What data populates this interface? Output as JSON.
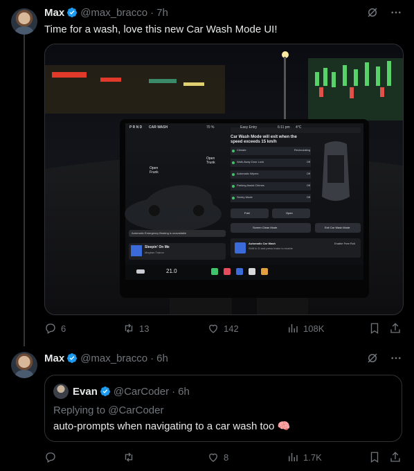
{
  "tweet1": {
    "author_name": "Max",
    "handle": "@max_bracco",
    "time": "7h",
    "text": "Time for a wash, love this new Car Wash Mode UI!",
    "media": {
      "top_bar": {
        "gear": "P R N D",
        "mode": "CAR WASH",
        "battery": "70 %",
        "entry": "Easy Entry",
        "clock": "6:11 pm",
        "temp": "4°C"
      },
      "open_frunk": "Open\nFrunk",
      "open_trunk": "Open\nTrunk",
      "aeb": "Automatic Emergency Braking is unavailable",
      "song": "Sleepin' On Me",
      "artist": "Meghan Trainor",
      "panel_title": "Car Wash Mode will exit when the speed exceeds 15 km/h",
      "rows": [
        {
          "label": "Climate",
          "value": "Recirculating"
        },
        {
          "label": "Walk-Away Door Lock",
          "value": "Off"
        },
        {
          "label": "Automatic Wipers",
          "value": "Off"
        },
        {
          "label": "Parking Assist Chimes",
          "value": "Off"
        },
        {
          "label": "Sentry Mode",
          "value": "Off"
        }
      ],
      "btn_fold": "Fold",
      "btn_open": "Open",
      "btn_screen_clean": "Screen Clean Mode",
      "btn_exit": "Exit Car Wash Mode",
      "card_title": "Automatic Car Wash",
      "card_sub": "Shift to D and press brake to enable",
      "card_right": "Enable Free Roll",
      "cabin_temp": "21.0"
    },
    "stats": {
      "replies": "6",
      "retweets": "13",
      "likes": "142",
      "views": "108K"
    }
  },
  "tweet2": {
    "author_name": "Max",
    "handle": "@max_bracco",
    "time": "6h",
    "quote": {
      "author_name": "Evan",
      "handle": "@CarCoder",
      "time": "6h",
      "replying_to": "Replying to @CarCoder",
      "text": "auto-prompts when navigating to a car wash too 🧠"
    },
    "stats": {
      "replies": "",
      "retweets": "",
      "likes": "8",
      "views": "1.7K"
    }
  },
  "colors": {
    "verified": "#1d9bf0",
    "muted": "#71767b",
    "text": "#e7e9ea",
    "border": "#2f3336"
  }
}
